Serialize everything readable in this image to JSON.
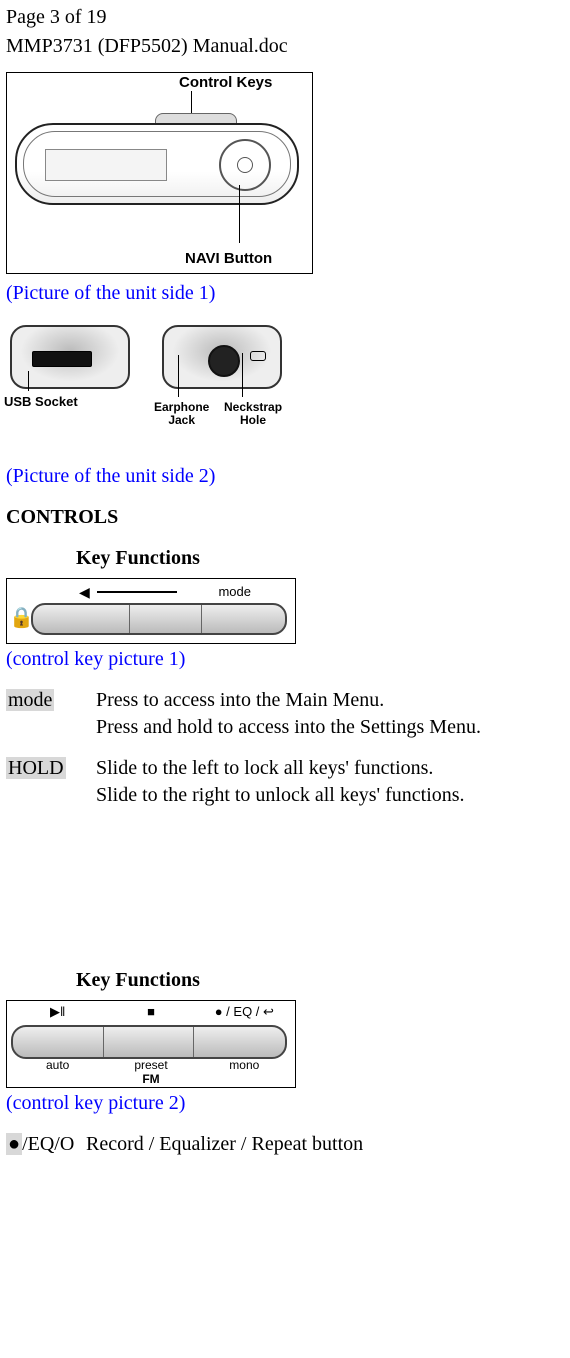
{
  "header": {
    "page_of": "Page 3 of 19",
    "doc_name": "MMP3731 (DFP5502) Manual.doc"
  },
  "figure_front": {
    "control_keys_label": "Control Keys",
    "navi_button_label": "NAVI Button"
  },
  "caption_side1": "(Picture of the unit side 1)",
  "figure_side": {
    "usb_label": "USB Socket",
    "jack_label_l1": "Earphone",
    "jack_label_l2": "Jack",
    "neck_label_l1": "Neckstrap",
    "neck_label_l2": "Hole"
  },
  "caption_side2": "(Picture of the unit side 2)",
  "section_controls": "CONTROLS",
  "subheading_keyfunc1": "Key Functions",
  "figure_ctrl1": {
    "mode_label": "mode"
  },
  "caption_ctrl1": "(control key picture 1)",
  "rows1": [
    {
      "key": "mode",
      "l1": "Press to access into the Main Menu.",
      "l2": "Press and hold to access into the Settings Menu."
    },
    {
      "key": "HOLD",
      "l1": "Slide to the left to lock all keys' functions.",
      "l2": "Slide to the right to unlock all keys' functions."
    }
  ],
  "subheading_keyfunc2": "Key Functions",
  "figure_ctrl2": {
    "top1": "▶ǁ",
    "top2": "■",
    "top3": "● / EQ / ↩",
    "bot1": "auto",
    "bot2": "preset",
    "bot3": "mono",
    "fm": "FM"
  },
  "caption_ctrl2": "(control key picture 2)",
  "rows2": {
    "key_prefix": "●",
    "key_rest": "/EQ/O",
    "desc": "Record / Equalizer / Repeat button"
  }
}
